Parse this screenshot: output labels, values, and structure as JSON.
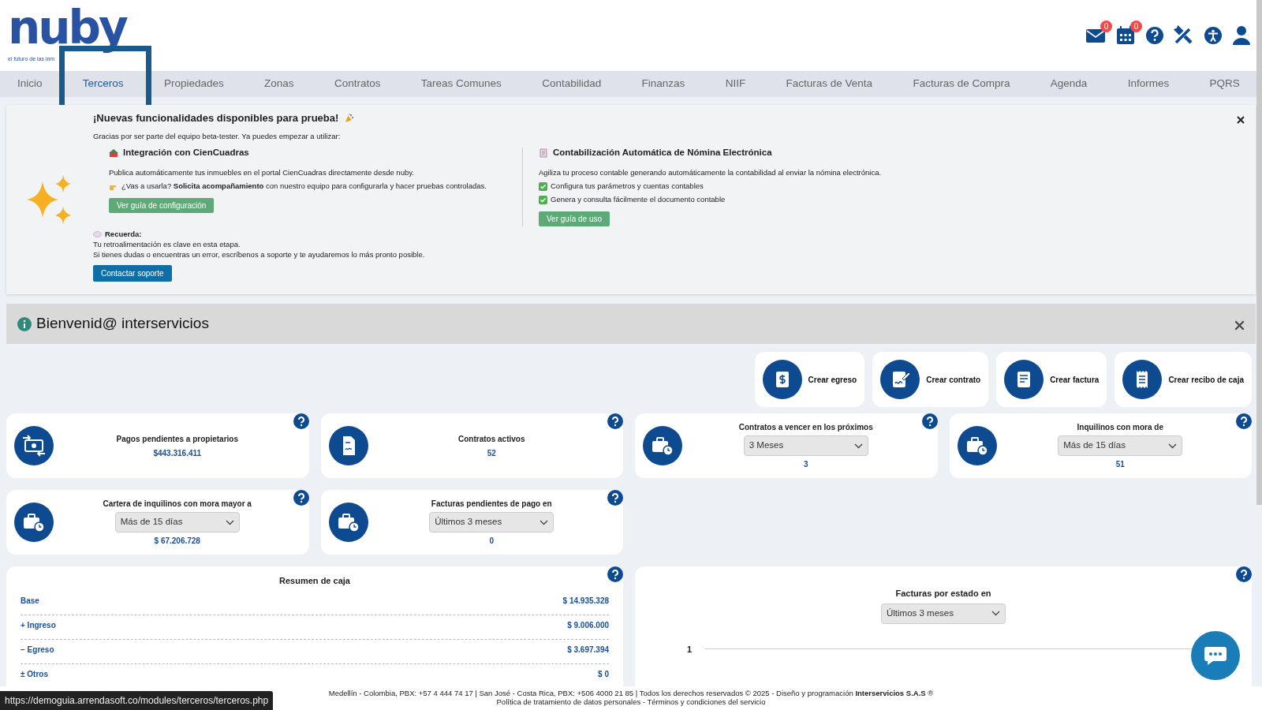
{
  "header": {
    "logo": "nuby",
    "tagline": "el futuro de las inm",
    "badges": [
      {
        "kind": "mail",
        "count": "0"
      },
      {
        "kind": "calendar",
        "count": "0"
      }
    ]
  },
  "nav": [
    {
      "label": "Inicio",
      "selected": false
    },
    {
      "label": "Terceros",
      "selected": true
    },
    {
      "label": "Propiedades",
      "selected": false
    },
    {
      "label": "Zonas",
      "selected": false
    },
    {
      "label": "Contratos",
      "selected": false
    },
    {
      "label": "Tareas Comunes",
      "selected": false
    },
    {
      "label": "Contabilidad",
      "selected": false
    },
    {
      "label": "Finanzas",
      "selected": false
    },
    {
      "label": "NIIF",
      "selected": false
    },
    {
      "label": "Facturas de Venta",
      "selected": false
    },
    {
      "label": "Facturas de Compra",
      "selected": false
    },
    {
      "label": "Agenda",
      "selected": false
    },
    {
      "label": "Informes",
      "selected": false
    },
    {
      "label": "PQRS",
      "selected": false
    }
  ],
  "banner": {
    "title": "¡Nuevas funcionalidades disponibles para prueba!",
    "intro": "Gracias por ser parte del equipo beta-tester. Ya puedes empezar a utilizar:",
    "features": [
      {
        "title": "Integración con CienCuadras",
        "lines": [
          {
            "kind": "plain",
            "text": "Publica automáticamente tus inmuebles en el portal CienCuadras directamente desde nuby."
          },
          {
            "kind": "hand",
            "text": "¿Vas a usarla? **Solicita acompañamiento** con nuestro equipo para configurarla y hacer pruebas controladas."
          }
        ],
        "button": "Ver guía de configuración"
      },
      {
        "title": "Contabilización Automática de Nómina Electrónica",
        "lines": [
          {
            "kind": "plain",
            "text": "Agiliza tu proceso contable generando automáticamente la contabilidad al enviar la nómina electrónica."
          },
          {
            "kind": "check",
            "text": "Configura tus parámetros y cuentas contables"
          },
          {
            "kind": "check",
            "text": "Genera y consulta fácilmente el documento contable"
          }
        ],
        "button": "Ver guía de uso"
      }
    ],
    "reminder_title": "Recuerda:",
    "reminder_lines": [
      "Tu retroalimentación es clave en esta etapa.",
      "Si tienes dudas o encuentras un error, escríbenos a soporte y te ayudaremos lo más pronto posible."
    ],
    "support_button": "Contactar soporte"
  },
  "welcome": {
    "text": "Bienvenid@ interservicios"
  },
  "quick_actions": [
    {
      "label": "Crear egreso"
    },
    {
      "label": "Crear contrato"
    },
    {
      "label": "Crear factura"
    },
    {
      "label": "Crear recibo de caja"
    }
  ],
  "stats": [
    {
      "title": "Pagos pendientes a propietarios",
      "kind": "value",
      "value": "$443.316.411"
    },
    {
      "title": "Contratos activos",
      "kind": "value",
      "value": "52"
    },
    {
      "title": "Contratos a vencer en los próximos",
      "kind": "select",
      "option": "3 Meses",
      "value": "3"
    },
    {
      "title": "Inquilinos con mora de",
      "kind": "select",
      "option": "Más de 15 días",
      "value": "51"
    },
    {
      "title": "Cartera de inquilinos con mora mayor a",
      "kind": "select",
      "option": "Más de 15 días",
      "value": "$ 67.206.728"
    },
    {
      "title": "Facturas pendientes de pago en",
      "kind": "select",
      "option": "Últimos 3 meses",
      "value": "0"
    }
  ],
  "cash_summary": {
    "title": "Resumen de caja",
    "rows": [
      {
        "sign": "",
        "label": "Base",
        "amount": "$ 14.935.328"
      },
      {
        "sign": "+",
        "label": "Ingreso",
        "amount": "$ 9.006.000"
      },
      {
        "sign": "−",
        "label": "Egreso",
        "amount": "$ 3.697.394"
      },
      {
        "sign": "±",
        "label": "Otros",
        "amount": "$ 0"
      }
    ]
  },
  "invoice_chart": {
    "title": "Facturas por estado en",
    "option": "Últimos 3 meses",
    "y_tick": "1"
  },
  "footer": {
    "line1": "Medellín - Colombia, PBX: +57 4 444 74 17 | San José - Costa Rica, PBX: +506 4000 21 85 | Todos los derechos reservados © 2025 - Diseño y programación **Interservicios S.A.S** ®",
    "line2": "Política de tratamiento de datos personales - Términos y condiciones del servicio"
  },
  "status_url": "https://demoguia.arrendasoft.co/modules/terceros/terceros.php"
}
